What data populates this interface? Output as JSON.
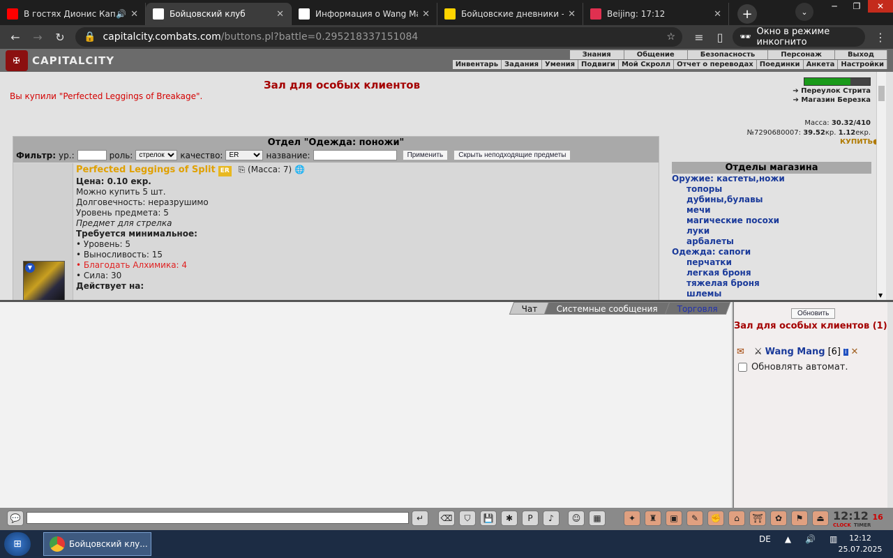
{
  "browser": {
    "tabs": [
      {
        "title": "В гостях Дионис Капта",
        "icon": "youtube-icon",
        "color": "#ff0000",
        "extra": "🔊"
      },
      {
        "title": "Бойцовский клуб",
        "icon": "combats-icon",
        "color": "#ffffff",
        "active": true
      },
      {
        "title": "Информация о Wang Mar",
        "icon": "combats-icon",
        "color": "#ffffff"
      },
      {
        "title": "Бойцовские дневники - W",
        "icon": "diary-icon",
        "color": "#ffd400"
      },
      {
        "title": "Beijing: 17:12",
        "icon": "clock-icon",
        "color": "#e03050"
      }
    ],
    "new_tab": "+",
    "tab_search": "⌄",
    "url_host": "capitalcity.combats.com",
    "url_path": "/buttons.pl?battle=0.295218337151084",
    "incognito_label": "Окно в режиме инкогнито"
  },
  "game": {
    "logo": "CAPITALCITY",
    "top_menu": [
      "Знания",
      "Общение",
      "Безопасность",
      "Персонаж",
      "Выход"
    ],
    "sub_menu": [
      "Инвентарь",
      "Задания",
      "Умения",
      "Подвиги",
      "Мой Скролл",
      "Отчет о переводах",
      "Поединки",
      "Анкета",
      "Настройки"
    ],
    "bought_msg": "Вы купили \"Perfected Leggings of Breakage\".",
    "hall_title": "Зал для особых клиентов",
    "right_links": [
      "Переулок Стрита",
      "Магазин Березка"
    ],
    "mass_label": "Масса:",
    "mass_value": "30.32/410",
    "account_no": "№7290680007:",
    "money_kr": "39.52",
    "kr_label": "кр.",
    "money_ekr": "1.12",
    "ekr_label": "екр.",
    "buy_label": "КУПИТЬ"
  },
  "dept": {
    "title": "Отдел \"Одежда: поножи\"",
    "filter_label": "Фильтр:",
    "lvl_label": "ур.:",
    "role_label": "роль:",
    "role_value": "стрелок",
    "quality_label": "качество:",
    "quality_value": "ER",
    "name_label": "название:",
    "apply_btn": "Применить",
    "hide_btn": "Скрыть неподходящие предметы"
  },
  "item": {
    "name": "Perfected Leggings of Split",
    "tag": "ER",
    "mass": "(Масса: 7)",
    "price": "Цена: 0.10 екр.",
    "can_buy": "Можно купить 5 шт.",
    "durability": "Долговечность: неразрушимо",
    "level": "Уровень предмета: 5",
    "for_class": "Предмет для стрелка",
    "req_title": "Требуется минимальное:",
    "req": [
      {
        "text": "• Уровень: 5",
        "red": false
      },
      {
        "text": "• Выносливость: 15",
        "red": false
      },
      {
        "text": "• Благодать Алхимика: 4",
        "red": true
      },
      {
        "text": "• Сила: 30",
        "red": false
      }
    ],
    "effects_title": "Действует на:"
  },
  "shop": {
    "title": "Отделы магазина",
    "entries": [
      {
        "text": "Оружие: кастеты,ножи",
        "cat": true
      },
      {
        "text": "топоры",
        "cat": false
      },
      {
        "text": "дубины,булавы",
        "cat": false
      },
      {
        "text": "мечи",
        "cat": false
      },
      {
        "text": "магические посохи",
        "cat": false
      },
      {
        "text": "луки",
        "cat": false
      },
      {
        "text": "арбалеты",
        "cat": false
      },
      {
        "text": "Одежда: сапоги",
        "cat": true
      },
      {
        "text": "перчатки",
        "cat": false
      },
      {
        "text": "легкая броня",
        "cat": false
      },
      {
        "text": "тяжелая броня",
        "cat": false
      },
      {
        "text": "шлемы",
        "cat": false
      }
    ]
  },
  "chat": {
    "tabs": [
      "Чат",
      "Системные сообщения",
      "Торговля"
    ]
  },
  "users": {
    "refresh": "Обновить",
    "room": "Зал для особых клиентов (1)",
    "user_name": "Wang Mang",
    "user_level": "[6]",
    "auto_refresh": "Обновлять автомат."
  },
  "clock": {
    "time": "12:12",
    "sec": "16",
    "label1": "CLOCK",
    "label2": "TIMER"
  },
  "taskbar": {
    "app_title": "Бойцовский клу...",
    "lang": "DE",
    "time": "12:12",
    "date": "25.07.2025"
  }
}
